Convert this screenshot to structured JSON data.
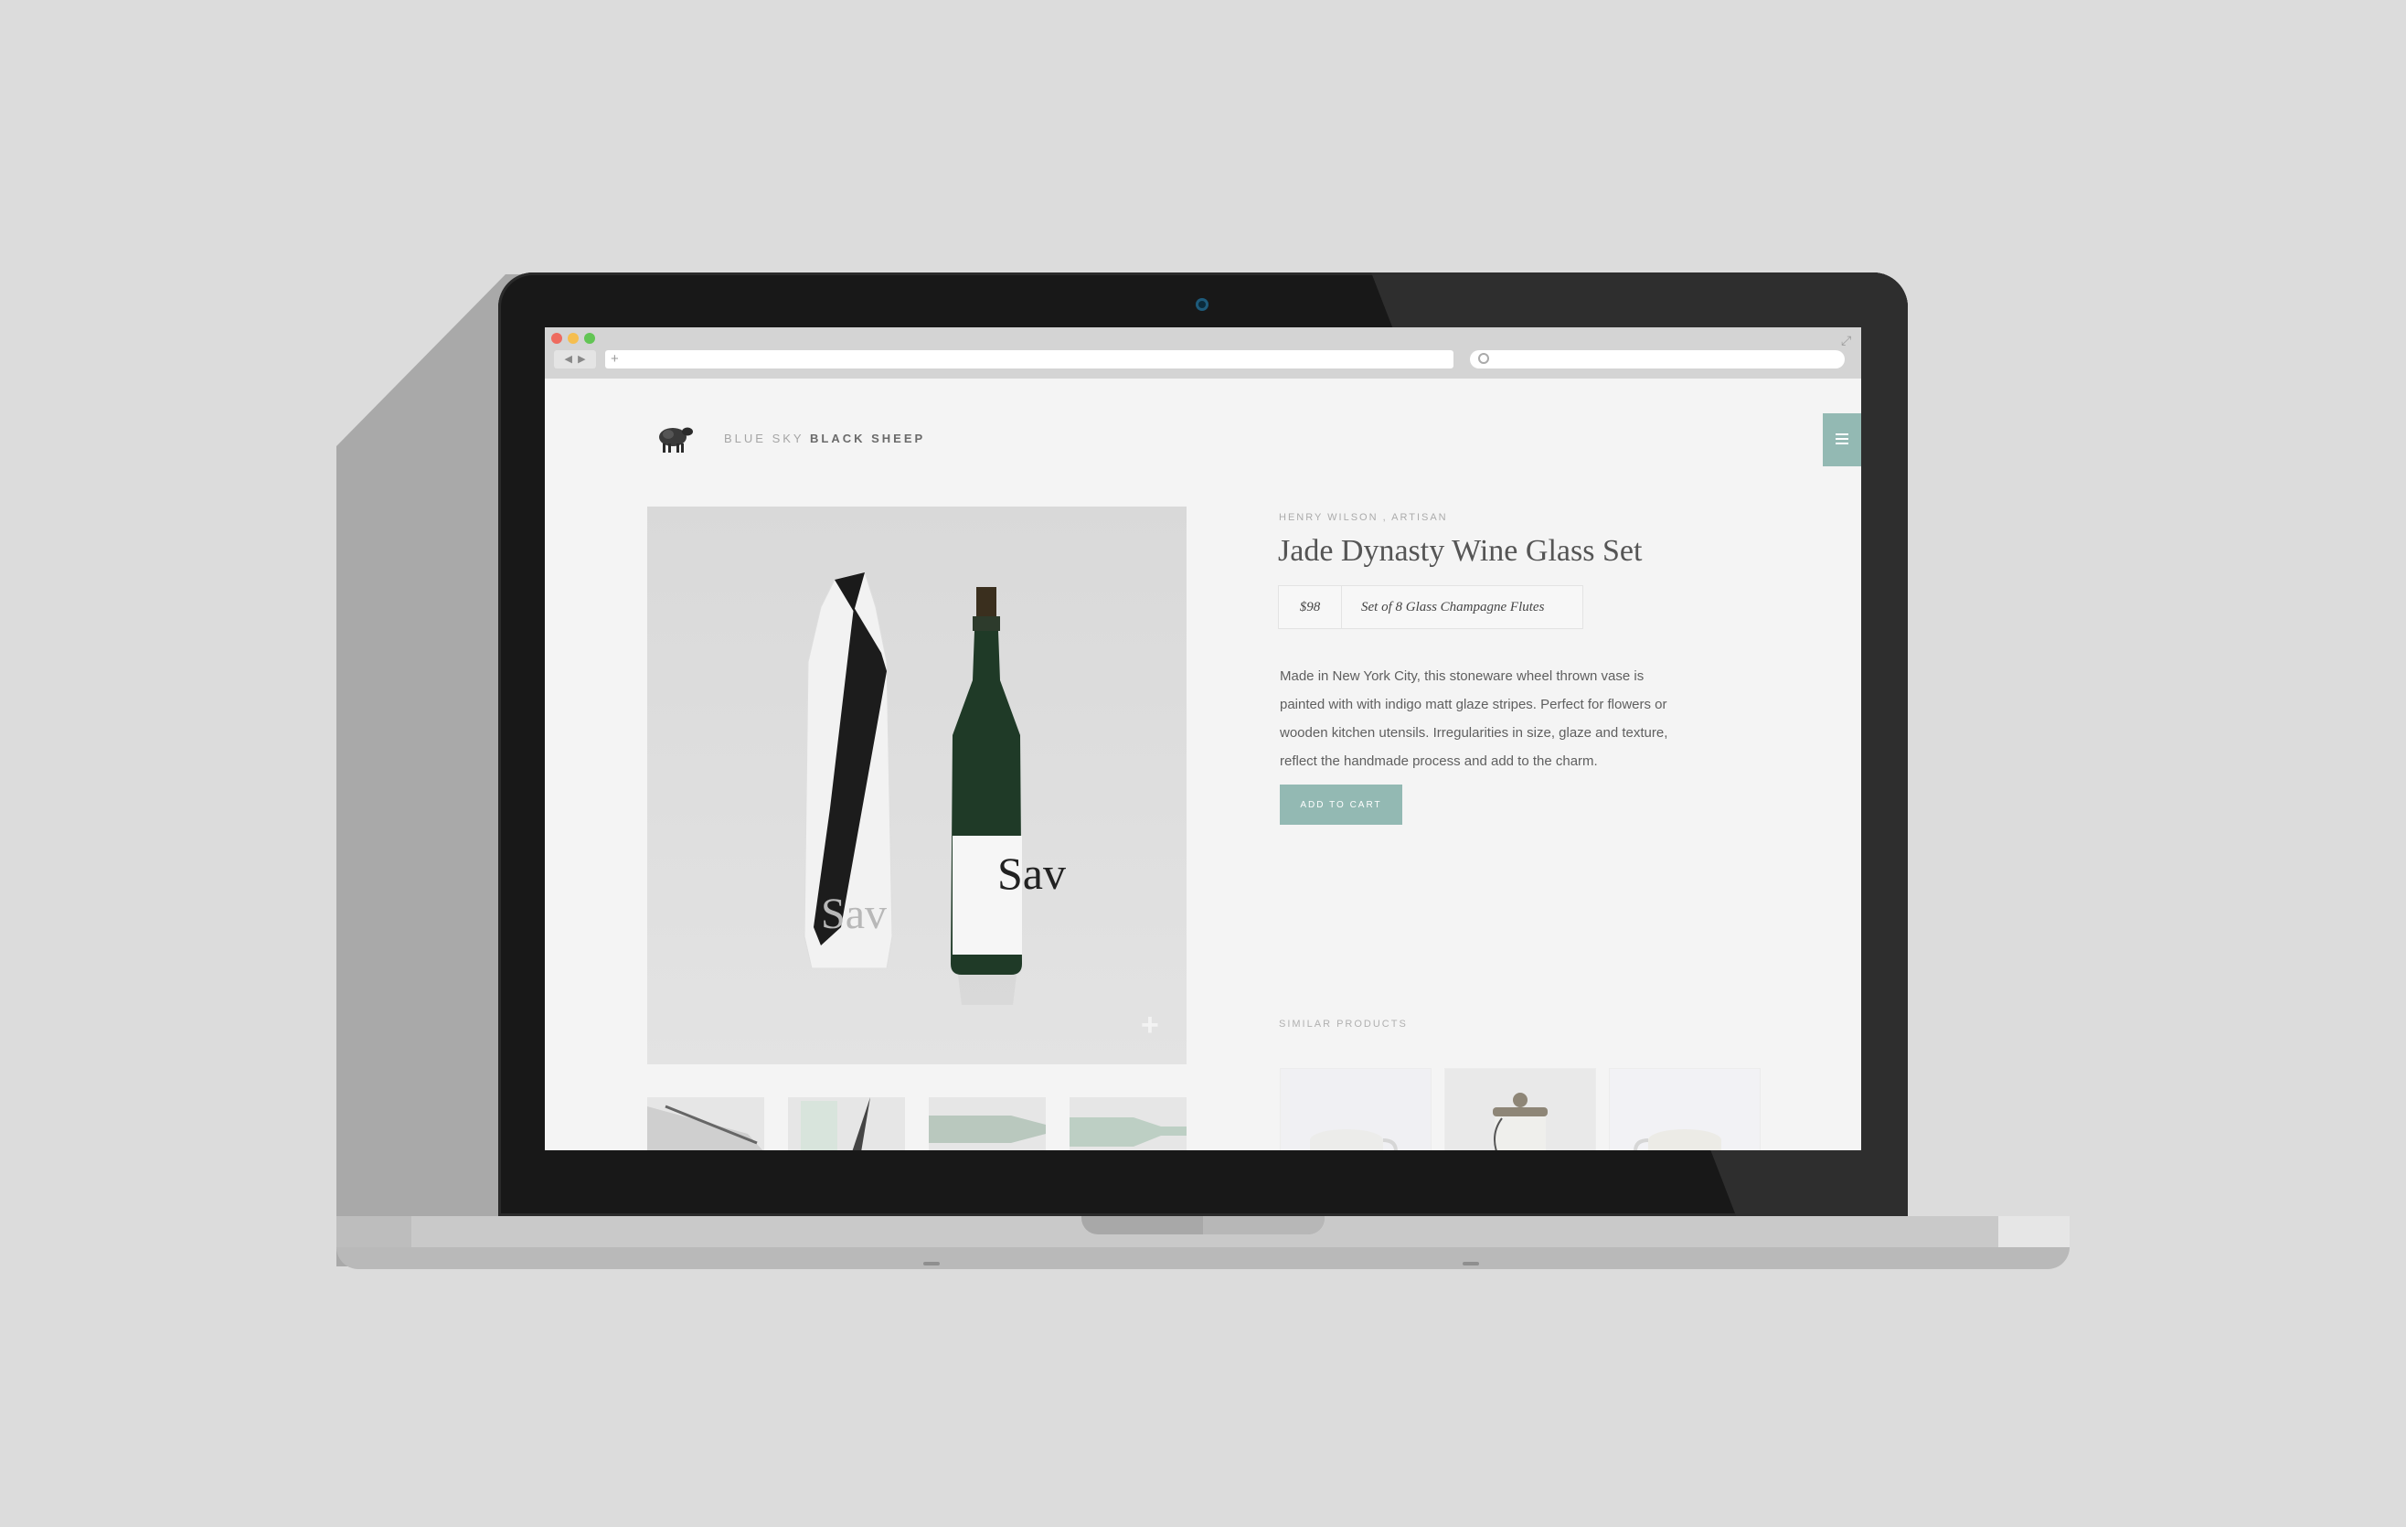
{
  "browser": {
    "url_value": "",
    "search_value": ""
  },
  "brand": {
    "part1": "BLUE SKY",
    "part2": "BLACK SHEEP"
  },
  "product": {
    "maker": "HENRY WILSON",
    "separator": ",",
    "role": "ARTISAN",
    "title": "Jade Dynasty Wine Glass Set",
    "price": "$98",
    "variant": "Set of 8 Glass Champagne Flutes",
    "description": "Made in New York City, this stoneware wheel thrown vase is painted with with indigo matt glaze stripes. Perfect for flowers or wooden kitchen utensils. Irregularities in size, glaze and texture, reflect the handmade process and add to the charm.",
    "add_to_cart": "ADD TO CART",
    "bottle_label": "Sav"
  },
  "similar": {
    "heading": "SIMILAR PRODUCTS"
  },
  "colors": {
    "accent": "#93b9b3",
    "page_bg": "#f4f4f4",
    "traffic_red": "#ee6b5f",
    "traffic_yellow": "#f5be4f",
    "traffic_green": "#62c554"
  },
  "icons": [
    "back-icon",
    "forward-icon",
    "new-tab-plus-icon",
    "search-icon",
    "expand-icon",
    "menu-icon",
    "zoom-plus-icon",
    "sheep-logo-icon"
  ]
}
